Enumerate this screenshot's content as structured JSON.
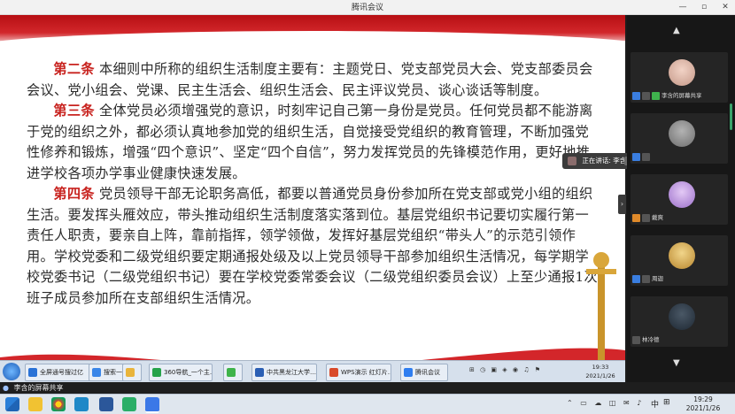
{
  "window": {
    "title": "腾讯会议",
    "controls": [
      "—",
      "▫",
      "✕"
    ]
  },
  "slide": {
    "paragraphs": [
      {
        "article": "第二条",
        "text": " 本细则中所称的组织生活制度主要有：主题党日、党支部党员大会、党支部委员会会议、党小组会、党课、民主生活会、组织生活会、民主评议党员、谈心谈话等制度。"
      },
      {
        "article": "第三条",
        "text": " 全体党员必须增强党的意识，时刻牢记自己第一身份是党员。任何党员都不能游离于党的组织之外，都必须认真地参加党的组织生活，自觉接受党组织的教育管理，不断加强党性修养和锻炼，增强“四个意识”、坚定“四个自信”，努力发挥党员的先锋模范作用，更好地推进学校各项办学事业健康快速发展。"
      },
      {
        "article": "第四条",
        "text": " 党员领导干部无论职务高低，都要以普通党员身份参加所在党支部或党小组的组织生活。要发挥头雁效应，带头推动组织生活制度落实落到位。基层党组织书记要切实履行第一责任人职责，要亲自上阵，靠前指挥，领学领做，发挥好基层党组织“带头人”的示范引领作用。学校党委和二级党组织要定期通报处级及以上党员领导干部参加组织生活情况，每学期学校党委书记（二级党组织书记）要在学校党委常委会议（二级党组织委员会议）上至少通报1次班子成员参加所在支部组织生活情况。"
      }
    ]
  },
  "shared_taskbar": {
    "items": [
      {
        "label": "全屏通号搜过亿",
        "color": "#2a72d6"
      },
      {
        "label": "搜索一下",
        "color": "#3a86e8"
      },
      {
        "label": "",
        "color": "#e9b43b"
      },
      {
        "label": "360导航_一个主…",
        "color": "#26a34a"
      },
      {
        "label": "",
        "color": "#3eb34a"
      },
      {
        "label": "中共黑龙江大学…",
        "color": "#2b5fb4"
      },
      {
        "label": "WPS演示 红灯片…",
        "color": "#d94a2a"
      },
      {
        "label": "腾讯会议",
        "color": "#2f7ef0"
      }
    ],
    "clock_time": "19:33",
    "clock_date": "2021/1/26"
  },
  "speaking_popup": {
    "text": "正在讲话: 李含;"
  },
  "participants": [
    {
      "name": "李含的屏幕共享",
      "avatar_color": "#d7b2a6"
    },
    {
      "name": "",
      "avatar_color": "#8f8f8f"
    },
    {
      "name": "戴爽",
      "avatar_color": "#c3a4e6"
    },
    {
      "name": "周迦",
      "avatar_color": "#d9b45a"
    },
    {
      "name": "林冷德",
      "avatar_color": "#2c3a46"
    }
  ],
  "share_bar": {
    "text": "李含的屏幕共享"
  },
  "taskbar": {
    "time": "19:29",
    "date": "2021/1/26",
    "ime": "中"
  }
}
